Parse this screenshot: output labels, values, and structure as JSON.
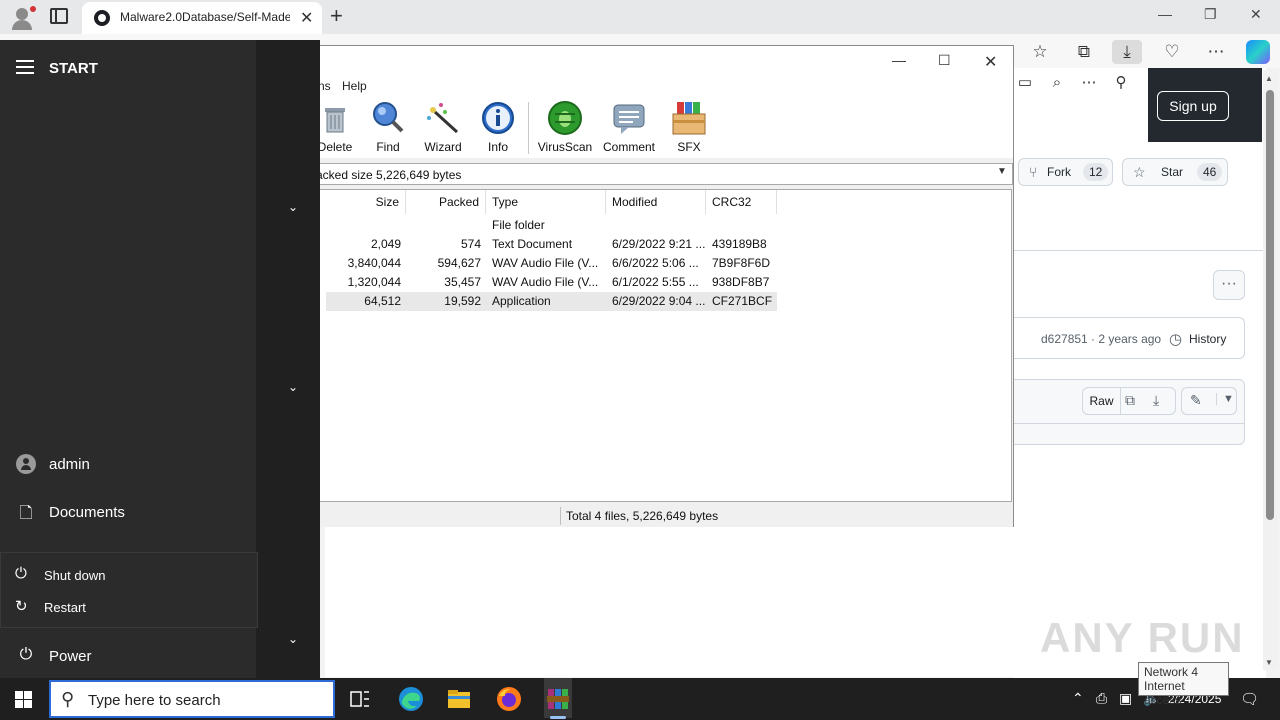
{
  "browser": {
    "tab_title": "Malware2.0Database/Self-Made/",
    "tab_close": "✕",
    "new_tab": "+",
    "minimize": "—",
    "restore": "❐",
    "close": "✕",
    "toolbar_icons": [
      "favorites-icon",
      "collections-icon",
      "downloads-icon",
      "browser-essentials-icon",
      "more-icon",
      "copilot-icon"
    ]
  },
  "github": {
    "sign_up": "Sign up",
    "fork_label": "Fork",
    "fork_count": "12",
    "star_label": "Star",
    "star_count": "46",
    "commit_info": "d627851 · 2 years ago",
    "history": "History",
    "raw": "Raw"
  },
  "winrar": {
    "menu_visible": [
      "ns",
      "Help"
    ],
    "tools": [
      {
        "label": "Delete",
        "icon": "delete-icon"
      },
      {
        "label": "Find",
        "icon": "find-icon"
      },
      {
        "label": "Wizard",
        "icon": "wizard-icon"
      },
      {
        "label": "Info",
        "icon": "info-icon"
      },
      {
        "label": "VirusScan",
        "icon": "virusscan-icon"
      },
      {
        "label": "Comment",
        "icon": "comment-icon"
      },
      {
        "label": "SFX",
        "icon": "sfx-icon"
      }
    ],
    "path_text": "acked size 5,226,649 bytes",
    "columns": [
      "Size",
      "Packed",
      "Type",
      "Modified",
      "CRC32"
    ],
    "rows": [
      {
        "size": "",
        "packed": "",
        "type": "File folder",
        "modified": "",
        "crc": ""
      },
      {
        "size": "2,049",
        "packed": "574",
        "type": "Text Document",
        "modified": "6/29/2022 9:21 ...",
        "crc": "439189B8"
      },
      {
        "size": "3,840,044",
        "packed": "594,627",
        "type": "WAV Audio File (V...",
        "modified": "6/6/2022 5:06 ...",
        "crc": "7B9F8F6D"
      },
      {
        "size": "1,320,044",
        "packed": "35,457",
        "type": "WAV Audio File (V...",
        "modified": "6/1/2022 5:55 ...",
        "crc": "938DF8B7"
      },
      {
        "size": "64,512",
        "packed": "19,592",
        "type": "Application",
        "modified": "6/29/2022 9:04 ...",
        "crc": "CF271BCF"
      }
    ],
    "status": "Total 4 files, 5,226,649 bytes"
  },
  "start_menu": {
    "title": "START",
    "user": "admin",
    "documents": "Documents",
    "shutdown": "Shut down",
    "restart": "Restart",
    "power": "Power"
  },
  "taskbar": {
    "search_placeholder": "Type here to search",
    "time": "",
    "date": "2/24/2025",
    "tooltip_line1": "Network  4",
    "tooltip_line2": "Internet access"
  },
  "watermark": "ANY RUN"
}
